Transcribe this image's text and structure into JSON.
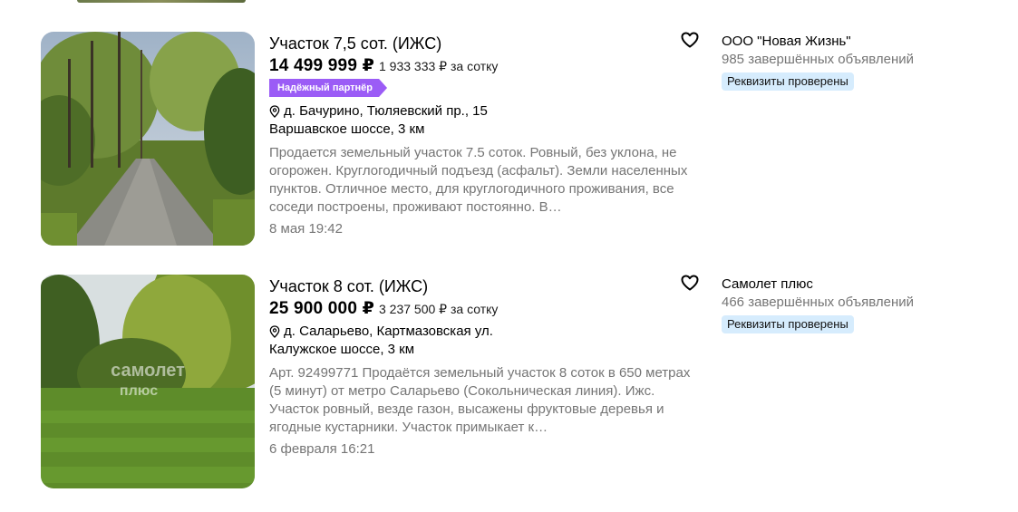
{
  "listings": [
    {
      "title": "Участок 7,5 сот. (ИЖС)",
      "price": "14 499 999 ₽",
      "price_per_unit": "1 933 333 ₽ за сотку",
      "badge": "Надёжный партнёр",
      "address": "д. Бачурино, Тюляевский пр., 15",
      "highway": "Варшавское шоссе, 3 км",
      "description": "Продается земельный участок 7.5 соток. Ровный, без уклона, не огорожен. Круглогодичный подъезд (асфальт). Земли населенных пунктов. Отличное место, для круглогодичного проживания, все соседи построены, проживают постоянно. В…",
      "date": "8 мая 19:42",
      "seller": {
        "name": "ООО \"Новая Жизнь\"",
        "completed": "985 завершённых объявлений",
        "verified": "Реквизиты проверены"
      }
    },
    {
      "title": "Участок 8 сот. (ИЖС)",
      "price": "25 900 000 ₽",
      "price_per_unit": "3 237 500 ₽ за сотку",
      "address": "д. Саларьево, Картмазовская ул.",
      "highway": "Калужское шоссе, 3 км",
      "description": "Арт. 92499771 Продаётся земельный участок 8 соток в 650 метрах (5 минут) от метро Саларьево (Сокольническая линия). Ижс. Участок ровный, везде газон, высажены фруктовые деревья и ягодные кустарники. Участок примыкает к…",
      "date": "6 февраля 16:21",
      "photo_watermark": [
        "самолет",
        "плюс"
      ],
      "seller": {
        "name": "Самолет плюс",
        "completed": "466 завершённых объявлений",
        "verified": "Реквизиты проверены"
      }
    }
  ],
  "icons": {
    "favorite": "heart-outline-icon",
    "location": "map-pin-icon"
  },
  "colors": {
    "badge": "#9b5cf6",
    "verified_bg": "#d6ecfd",
    "muted_text": "#757575"
  }
}
